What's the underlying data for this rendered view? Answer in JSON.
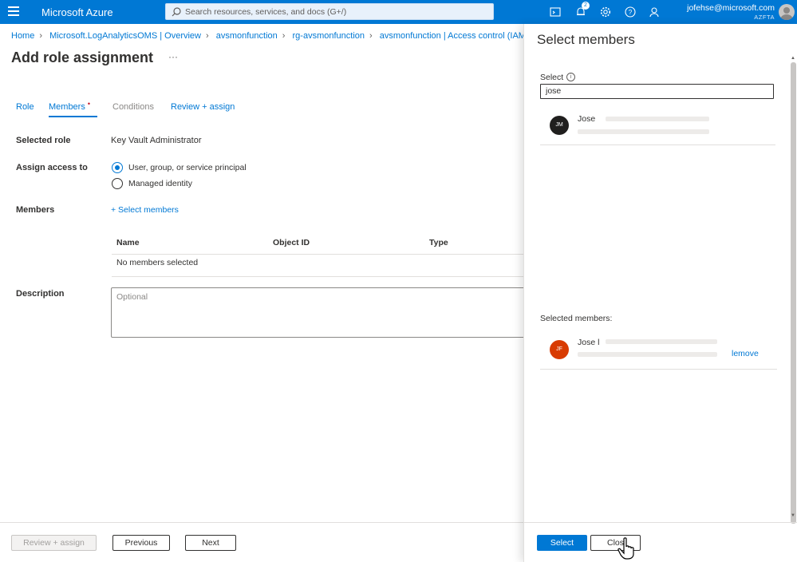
{
  "topbar": {
    "brand": "Microsoft Azure",
    "search_placeholder": "Search resources, services, and docs (G+/)",
    "notification_count": "2",
    "account_email": "jofehse@microsoft.com",
    "account_directory": "AZFTA",
    "accent_color": "#0078d4"
  },
  "breadcrumb": [
    "Home",
    "Microsoft.LogAnalyticsOMS | Overview",
    "avsmonfunction",
    "rg-avsmonfunction",
    "avsmonfunction | Access control (IAM"
  ],
  "page": {
    "title": "Add role assignment",
    "more": "···"
  },
  "tabs": [
    {
      "label": "Role"
    },
    {
      "label": "Members",
      "required": "•"
    },
    {
      "label": "Conditions"
    },
    {
      "label": "Review + assign"
    }
  ],
  "form": {
    "selected_role_label": "Selected role",
    "selected_role_value": "Key Vault Administrator",
    "assign_access_label": "Assign access to",
    "option_user": "User, group, or service principal",
    "option_managed": "Managed identity",
    "members_label": "Members",
    "select_members_link": "+ Select members",
    "table": {
      "columns": [
        "Name",
        "Object ID",
        "Type"
      ],
      "empty_text": "No members selected"
    },
    "description_label": "Description",
    "description_placeholder": "Optional"
  },
  "footer": {
    "review_assign": "Review + assign",
    "previous": "Previous",
    "next": "Next"
  },
  "panel": {
    "title": "Select members",
    "select_label": "Select",
    "info_icon": "i",
    "search_value": "jose",
    "result": {
      "initials": "JM",
      "name": "Jose"
    },
    "selected_members_label": "Selected members:",
    "selected_member": {
      "initials": "JF",
      "name": "Jose l",
      "remove_label": "lemove"
    },
    "select_button": "Select",
    "close_button": "Clos"
  }
}
